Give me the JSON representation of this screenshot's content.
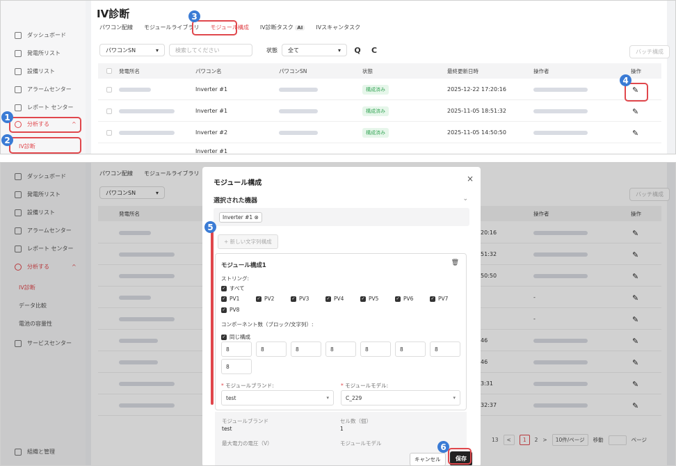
{
  "sidebar": {
    "items": [
      "ダッシュボード",
      "発電所リスト",
      "設備リスト",
      "アラームセンター",
      "レポート センター",
      "分析する"
    ],
    "sub_iv": "IV診断",
    "sub_data": "データ比較",
    "sub_pwr": "電池の容量性",
    "service": "サービスセンター",
    "org": "組織と管理",
    "chevron": "^"
  },
  "page": {
    "title": "IV診断",
    "tabs": [
      "パワコン配線",
      "モジュールライブラリ",
      "モジュール構成",
      "IV診断タスク",
      "IVスキャンタスク"
    ],
    "ai": "AI"
  },
  "filter": {
    "field": "パワコンSN",
    "placeholder": "検索してください",
    "status_label": "状態",
    "status_value": "全て",
    "batch": "バッチ構成",
    "search_icon": "Q",
    "reset_icon": "C"
  },
  "table": {
    "headers": [
      "発電所名",
      "パワコン名",
      "パワコンSN",
      "状態",
      "最終更新日時",
      "操作者",
      "操作"
    ],
    "rows": [
      {
        "inverter": "Inverter #1",
        "status": "構成済み",
        "updated": "2025-12-22 17:20:16"
      },
      {
        "inverter": "Inverter #1",
        "status": "構成済み",
        "updated": "2025-11-05 18:51:32"
      },
      {
        "inverter": "Inverter #2",
        "status": "構成済み",
        "updated": "2025-11-05 14:50:50"
      },
      {
        "inverter": "Inverter #1",
        "status": "",
        "updated": ""
      }
    ],
    "p2_frag": [
      "20:16",
      "51:32",
      "50:50",
      "-",
      "-",
      "-",
      "46",
      "46",
      "3:31",
      "32:37"
    ]
  },
  "modal": {
    "title": "モジュール構成",
    "close": "×",
    "selected_label": "選択された機器",
    "chip": "Inverter #1 ⊗",
    "add_btn": "+ 新しい文字列構成",
    "cfg_title": "モジュール構成1",
    "string_label": "ストリング:",
    "all": "すべて",
    "pvs": [
      "PV1",
      "PV2",
      "PV3",
      "PV4",
      "PV5",
      "PV6",
      "PV7",
      "PV8"
    ],
    "comp_label": "コンポーネント数（ブロック/文字列）:",
    "same": "同じ構成",
    "nums": [
      "8",
      "8",
      "8",
      "8",
      "8",
      "8",
      "8",
      "8"
    ],
    "brand_label": "モジュールブランド:",
    "model_label": "モジュールモデル:",
    "brand_value": "test",
    "model_value": "C_229",
    "grey": {
      "brand_label": "モジュールブランド",
      "brand_value": "test",
      "cells_label": "セル数（個）",
      "cells_value": "1",
      "vmax_label": "最大電力の電圧（V）",
      "model_label": "モジュールモデル"
    },
    "cancel": "キャンセル",
    "save": "保存"
  },
  "pager": {
    "prefix": "13",
    "prev": "<",
    "p1": "1",
    "p2": "2",
    "next": ">",
    "size": "10件/ページ",
    "goto": "移動",
    "page": "ページ"
  },
  "markers": [
    "1",
    "2",
    "3",
    "4",
    "5",
    "6"
  ],
  "colors": {
    "accent": "#e0474c",
    "marker": "#3a7bd5"
  }
}
